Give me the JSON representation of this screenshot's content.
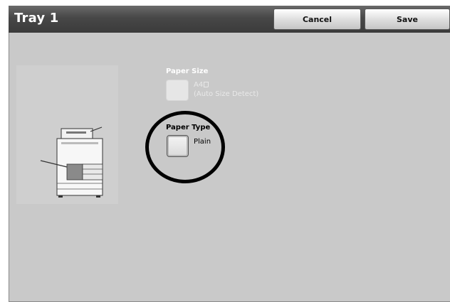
{
  "window": {
    "title": "Tray 1"
  },
  "toolbar": {
    "cancel_label": "Cancel",
    "save_label": "Save"
  },
  "paper_size": {
    "label": "Paper Size",
    "value": "A4",
    "detail": "(Auto Size Detect)",
    "icon": "portrait-orientation-icon"
  },
  "paper_type": {
    "label": "Paper Type",
    "value": "Plain"
  },
  "colors": {
    "titlebar": "#474747",
    "panel": "#c9c9c9",
    "highlight_ring": "#000000"
  }
}
